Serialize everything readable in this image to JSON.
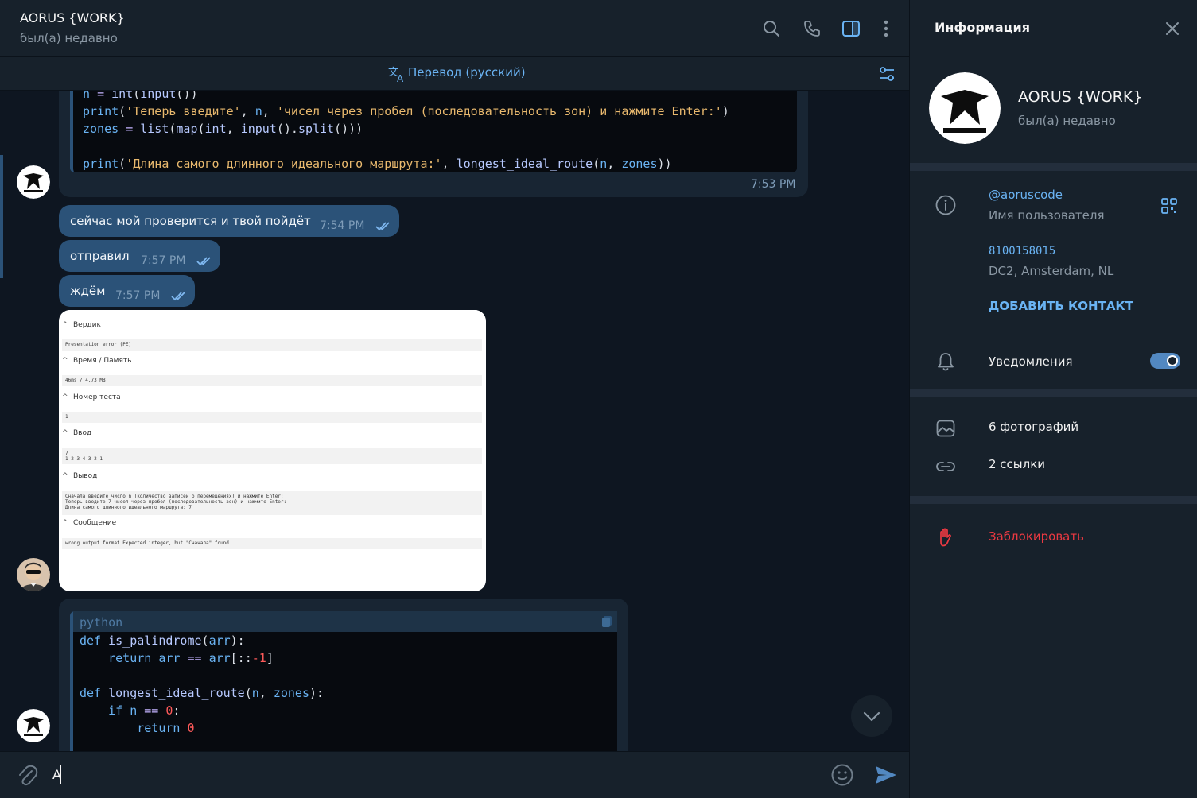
{
  "header": {
    "chat_title": "AORUS {WORK}",
    "status": "был(а) недавно"
  },
  "translate_bar": {
    "label": "Перевод (русский)"
  },
  "messages": {
    "code_top": {
      "lines": [
        [
          {
            "t": "n ",
            "c": "kw"
          },
          {
            "t": "= ",
            "c": "op"
          },
          {
            "t": "int",
            "c": "fn"
          },
          {
            "t": "(",
            "c": "def"
          },
          {
            "t": "input",
            "c": "fn"
          },
          {
            "t": "())",
            "c": "def"
          }
        ],
        [
          {
            "t": "print",
            "c": "kw"
          },
          {
            "t": "(",
            "c": "def"
          },
          {
            "t": "'Теперь введите'",
            "c": "str"
          },
          {
            "t": ", ",
            "c": "def"
          },
          {
            "t": "n",
            "c": "kw"
          },
          {
            "t": ", ",
            "c": "def"
          },
          {
            "t": "'чисел через пробел (последовательность зон) и нажмите Enter:'",
            "c": "str"
          },
          {
            "t": ")",
            "c": "def"
          }
        ],
        [
          {
            "t": "zones ",
            "c": "kw"
          },
          {
            "t": "= ",
            "c": "op"
          },
          {
            "t": "list",
            "c": "fn"
          },
          {
            "t": "(",
            "c": "def"
          },
          {
            "t": "map",
            "c": "fn"
          },
          {
            "t": "(",
            "c": "def"
          },
          {
            "t": "int",
            "c": "fn"
          },
          {
            "t": ", ",
            "c": "def"
          },
          {
            "t": "input",
            "c": "fn"
          },
          {
            "t": "().",
            "c": "def"
          },
          {
            "t": "split",
            "c": "fn"
          },
          {
            "t": "()))",
            "c": "def"
          }
        ],
        [],
        [
          {
            "t": "print",
            "c": "kw"
          },
          {
            "t": "(",
            "c": "def"
          },
          {
            "t": "'Длина самого длинного идеального маршрута:'",
            "c": "str"
          },
          {
            "t": ", ",
            "c": "def"
          },
          {
            "t": "longest_ideal_route",
            "c": "fn"
          },
          {
            "t": "(",
            "c": "def"
          },
          {
            "t": "n",
            "c": "kw"
          },
          {
            "t": ", ",
            "c": "def"
          },
          {
            "t": "zones",
            "c": "kw"
          },
          {
            "t": "))",
            "c": "def"
          }
        ]
      ],
      "time": "7:53 PM"
    },
    "out1": {
      "text": "сейчас мой проверится и твой пойдёт",
      "time": "7:54 PM"
    },
    "out2": {
      "text": "отправил",
      "time": "7:57 PM"
    },
    "out3": {
      "text": "ждём",
      "time": "7:57 PM"
    },
    "screenshot": {
      "sections": [
        {
          "label": "Вердикт",
          "value": "Presentation error (PE)"
        },
        {
          "label": "Время / Память",
          "value": "46ms / 4.73 MB"
        },
        {
          "label": "Номер теста",
          "value": "1"
        },
        {
          "label": "Ввод",
          "value": "7\n1 2 3 4 3 2 1"
        },
        {
          "label": "Вывод",
          "value": "Сначала введите число n (количество записей о перемещениях) и нажмите Enter:\nТеперь введите 7 чисел через пробел (последовательность зон) и нажмите Enter:\nДлина самого длинного идеального маршрута: 7"
        },
        {
          "label": "Сообщение",
          "value": "wrong output format Expected integer, but \"Сначала\" found"
        }
      ]
    },
    "code_bottom": {
      "lang": "python",
      "lines": [
        [
          {
            "t": "def ",
            "c": "kw"
          },
          {
            "t": "is_palindrome",
            "c": "fn"
          },
          {
            "t": "(",
            "c": "def"
          },
          {
            "t": "arr",
            "c": "kw"
          },
          {
            "t": "):",
            "c": "def"
          }
        ],
        [
          {
            "t": "    return ",
            "c": "kw"
          },
          {
            "t": "arr ",
            "c": "kw"
          },
          {
            "t": "== ",
            "c": "op"
          },
          {
            "t": "arr",
            "c": "kw"
          },
          {
            "t": "[::",
            "c": "def"
          },
          {
            "t": "-1",
            "c": "num"
          },
          {
            "t": "]",
            "c": "def"
          }
        ],
        [],
        [
          {
            "t": "def ",
            "c": "kw"
          },
          {
            "t": "longest_ideal_route",
            "c": "fn"
          },
          {
            "t": "(",
            "c": "def"
          },
          {
            "t": "n",
            "c": "kw"
          },
          {
            "t": ", ",
            "c": "def"
          },
          {
            "t": "zones",
            "c": "kw"
          },
          {
            "t": "):",
            "c": "def"
          }
        ],
        [
          {
            "t": "    if ",
            "c": "kw"
          },
          {
            "t": "n ",
            "c": "kw"
          },
          {
            "t": "== ",
            "c": "op"
          },
          {
            "t": "0",
            "c": "num"
          },
          {
            "t": ":",
            "c": "def"
          }
        ],
        [
          {
            "t": "        return ",
            "c": "kw"
          },
          {
            "t": "0",
            "c": "num"
          }
        ]
      ]
    }
  },
  "composer": {
    "value": "A"
  },
  "info": {
    "title": "Информация",
    "name": "AORUS {WORK}",
    "status": "был(а) недавно",
    "username": "@aoruscode",
    "username_label": "Имя пользователя",
    "id": "8100158015",
    "dc": "DC2, Amsterdam, NL",
    "add_contact": "ДОБАВИТЬ КОНТАКТ",
    "notifications": "Уведомления",
    "notifications_on": true,
    "photos": "6 фотографий",
    "links": "2 ссылки",
    "block": "Заблокировать"
  },
  "colors": {
    "accent": "#6ab3f3",
    "outgoing": "#2b5278",
    "danger": "#ec3942",
    "background": "#0e1621",
    "panel": "#17212b"
  }
}
